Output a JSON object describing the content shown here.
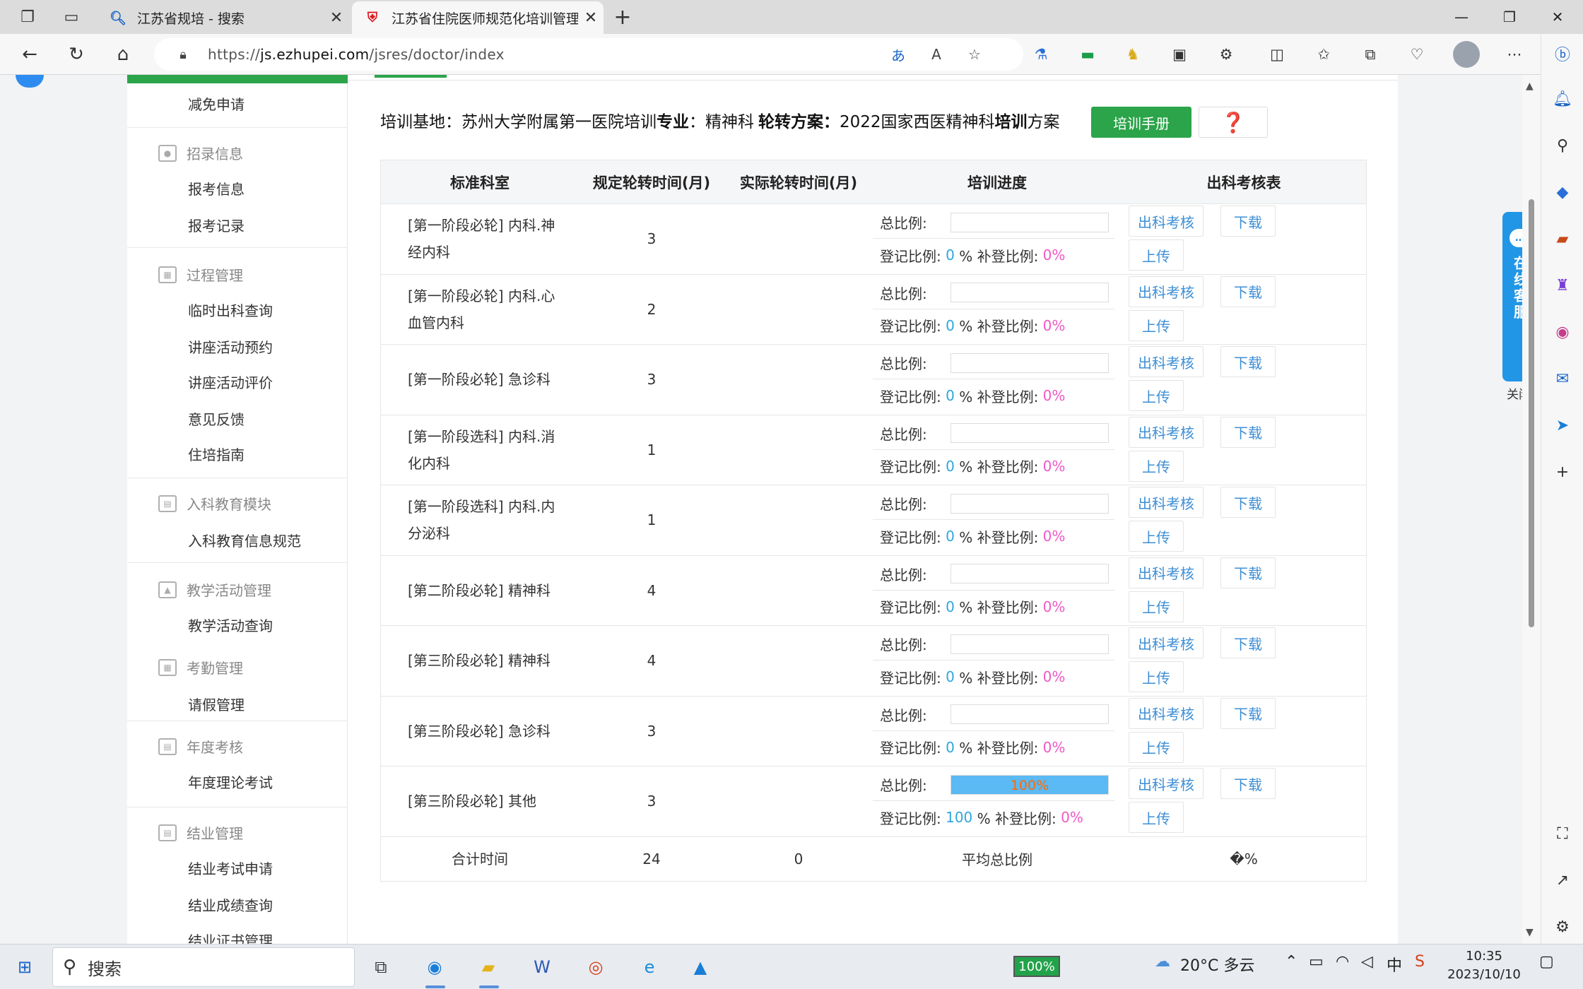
{
  "browser": {
    "tabs": [
      {
        "title": "江苏省规培 - 搜索",
        "active": false
      },
      {
        "title": "江苏省住院医师规范化培训管理平台",
        "active": true
      }
    ],
    "new_tab": "+",
    "url_prefix": "https://",
    "url_host": "js.ezhupei.com",
    "url_path": "/jsres/doctor/index",
    "translate_icon": "translate-icon",
    "read_aloud_icon": "read-aloud-icon",
    "favorite_icon": "star-icon"
  },
  "sidebar": {
    "items": [
      {
        "type": "item",
        "label": "减免申请"
      },
      {
        "type": "group",
        "label": "招录信息",
        "icon": "user-icon"
      },
      {
        "type": "item",
        "label": "报考信息"
      },
      {
        "type": "item",
        "label": "报考记录"
      },
      {
        "type": "group",
        "label": "过程管理",
        "icon": "process-icon"
      },
      {
        "type": "item",
        "label": "临时出科查询"
      },
      {
        "type": "item",
        "label": "讲座活动预约"
      },
      {
        "type": "item",
        "label": "讲座活动评价"
      },
      {
        "type": "item",
        "label": "意见反馈"
      },
      {
        "type": "item",
        "label": "住培指南"
      },
      {
        "type": "group",
        "label": "入科教育模块",
        "icon": "document-icon"
      },
      {
        "type": "item",
        "label": "入科教育信息规范"
      },
      {
        "type": "group",
        "label": "教学活动管理",
        "icon": "graduation-icon"
      },
      {
        "type": "item",
        "label": "教学活动查询"
      },
      {
        "type": "group",
        "label": "考勤管理",
        "icon": "attendance-icon"
      },
      {
        "type": "item",
        "label": "请假管理"
      },
      {
        "type": "group",
        "label": "年度考核",
        "icon": "exam-icon"
      },
      {
        "type": "item",
        "label": "年度理论考试"
      },
      {
        "type": "group",
        "label": "结业管理",
        "icon": "certificate-icon"
      },
      {
        "type": "item",
        "label": "结业考试申请"
      },
      {
        "type": "item",
        "label": "结业成绩查询"
      },
      {
        "type": "item",
        "label": "结业证书管理"
      }
    ]
  },
  "info": {
    "base_label": "培训基地：",
    "base_value": "苏州大学附属第一医院",
    "spec_label_a": " 培训",
    "spec_label_b": "专业",
    "spec_colon": "：",
    "spec_value": "精神科 ",
    "plan_label": "轮转方案：",
    "plan_value_a": "2022国家西医精神科",
    "plan_value_b": "培训",
    "plan_value_c": "方案",
    "manual_button": "培训手册",
    "help_button": "❓"
  },
  "table": {
    "headers": [
      "标准科室",
      "规定轮转时间(月)",
      "实际轮转时间(月)",
      "培训进度",
      "出科考核表"
    ],
    "total_ratio_label": "总比例:",
    "reg_ratio_label": "登记比例:",
    "supp_ratio_label": "% 补登比例:",
    "btn_exam": "出科考核",
    "btn_download": "下载",
    "btn_upload": "上传",
    "rows": [
      {
        "dept": "[第一阶段必轮] 内科.神经内科",
        "required": "3",
        "actual": "",
        "progress_text": "",
        "progress": 0,
        "reg": "0",
        "supp": "0%"
      },
      {
        "dept": "[第一阶段必轮] 内科.心血管内科",
        "required": "2",
        "actual": "",
        "progress_text": "",
        "progress": 0,
        "reg": "0",
        "supp": "0%"
      },
      {
        "dept": "[第一阶段必轮] 急诊科",
        "required": "3",
        "actual": "",
        "progress_text": "",
        "progress": 0,
        "reg": "0",
        "supp": "0%"
      },
      {
        "dept": "[第一阶段选科] 内科.消化内科",
        "required": "1",
        "actual": "",
        "progress_text": "",
        "progress": 0,
        "reg": "0",
        "supp": "0%"
      },
      {
        "dept": "[第一阶段选科] 内科.内分泌科",
        "required": "1",
        "actual": "",
        "progress_text": "",
        "progress": 0,
        "reg": "0",
        "supp": "0%"
      },
      {
        "dept": "[第二阶段必轮] 精神科",
        "required": "4",
        "actual": "",
        "progress_text": "",
        "progress": 0,
        "reg": "0",
        "supp": "0%"
      },
      {
        "dept": "[第三阶段必轮] 精神科",
        "required": "4",
        "actual": "",
        "progress_text": "",
        "progress": 0,
        "reg": "0",
        "supp": "0%"
      },
      {
        "dept": "[第三阶段必轮] 急诊科",
        "required": "3",
        "actual": "",
        "progress_text": "",
        "progress": 0,
        "reg": "0",
        "supp": "0%"
      },
      {
        "dept": "[第三阶段必轮] 其他",
        "required": "3",
        "actual": "",
        "progress_text": "100%",
        "progress": 100,
        "reg": "100",
        "supp": "0%"
      }
    ],
    "footer": {
      "label": "合计时间",
      "required_total": "24",
      "actual_total": "0",
      "avg_label": "平均总比例",
      "avg_value": "�%"
    }
  },
  "chat_float": {
    "label": "在线客服",
    "close": "关闭"
  },
  "taskbar": {
    "search_placeholder": "搜索",
    "battery": "100%",
    "weather": "20°C 多云",
    "time": "10:35",
    "date": "2023/10/10",
    "ime": "中"
  },
  "colors": {
    "green": "#2ba44a",
    "link": "#3e8fd6",
    "cyan": "#2fa6df",
    "pink": "#f058c6",
    "bar": "#5bb9f3"
  }
}
